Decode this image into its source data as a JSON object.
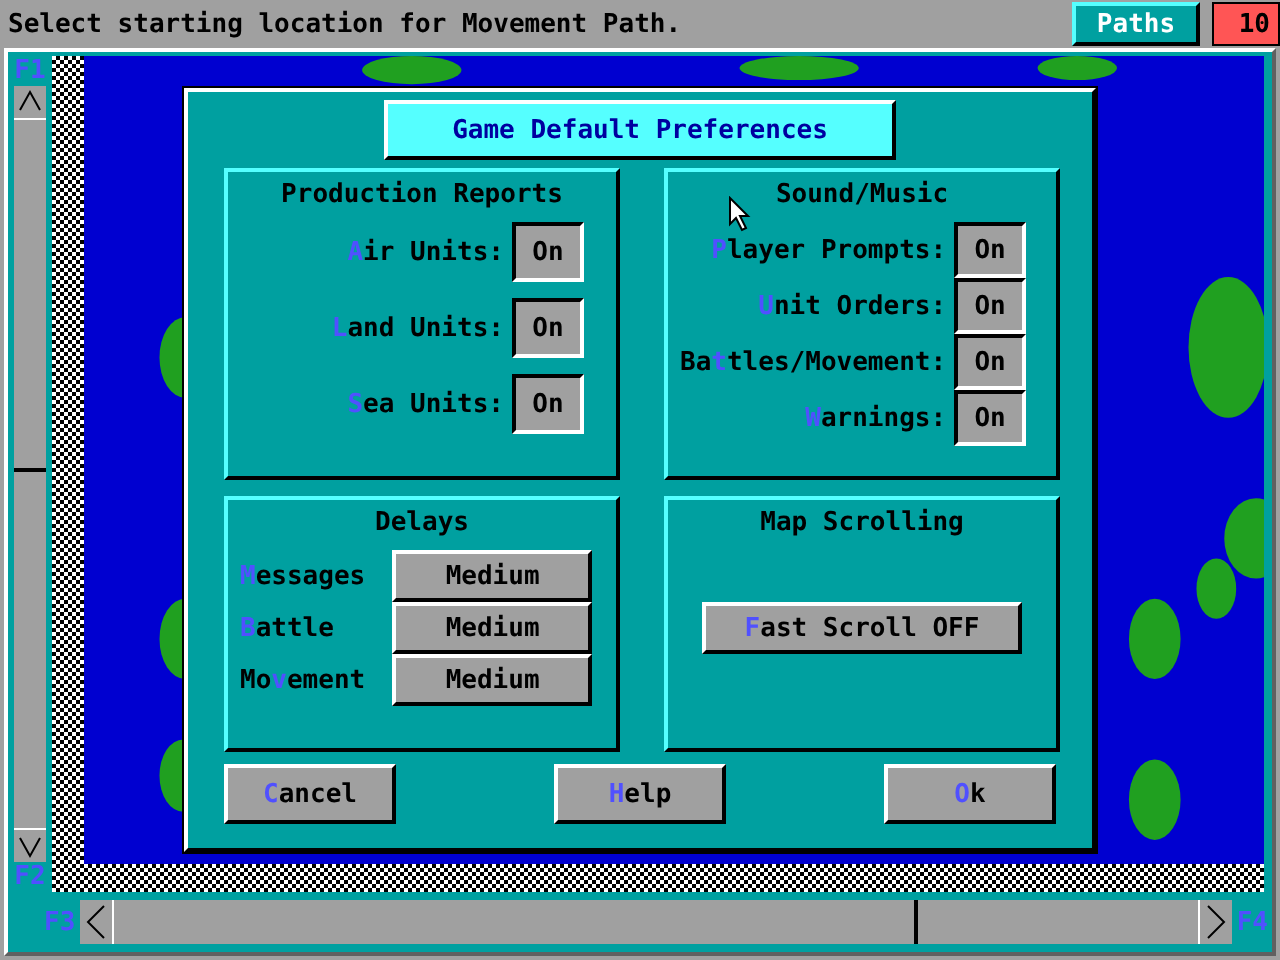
{
  "status_bar": {
    "message": "Select starting location for Movement Path.",
    "mode_button": "Paths",
    "counter": "10"
  },
  "scroll_keys": {
    "up": "F1",
    "down": "F2",
    "left": "F3",
    "right": "F4"
  },
  "dialog": {
    "title": "Game Default Preferences",
    "production_reports": {
      "title": "Production Reports",
      "items": [
        {
          "key": "A",
          "after": "ir Units:",
          "value": "On"
        },
        {
          "key": "L",
          "after": "and Units:",
          "value": "On"
        },
        {
          "key": "S",
          "after": "ea Units:",
          "value": "On"
        }
      ]
    },
    "sound_music": {
      "title": "Sound/Music",
      "items": [
        {
          "key": "P",
          "after": "layer Prompts:",
          "value": "On"
        },
        {
          "key": "U",
          "after": "nit Orders:",
          "value": "On"
        },
        {
          "before": "Ba",
          "key": "t",
          "after": "tles/Movement:",
          "value": "On"
        },
        {
          "key": "W",
          "after": "arnings:",
          "value": "On"
        }
      ]
    },
    "delays": {
      "title": "Delays",
      "items": [
        {
          "key": "M",
          "after": "essages",
          "value": "Medium"
        },
        {
          "key": "B",
          "after": "attle",
          "value": "Medium"
        },
        {
          "before": "Mo",
          "key": "v",
          "after": "ement",
          "value": "Medium"
        }
      ]
    },
    "map_scrolling": {
      "title": "Map Scrolling",
      "button": {
        "key": "F",
        "after": "ast Scroll OFF"
      }
    },
    "buttons": [
      {
        "key": "C",
        "after": "ancel"
      },
      {
        "key": "H",
        "after": "elp"
      },
      {
        "key": "O",
        "after": "k"
      }
    ]
  }
}
